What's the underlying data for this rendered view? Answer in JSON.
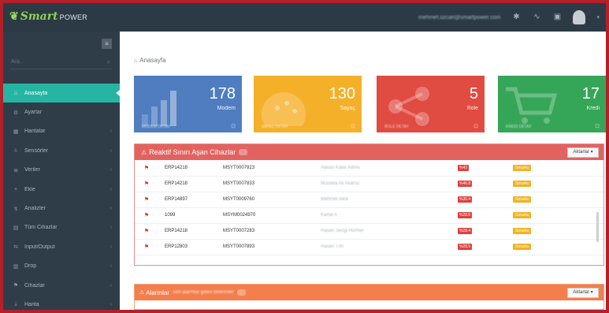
{
  "app": {
    "brand": "Smart",
    "brand_suffix": "POWER",
    "email": "mehmet.ozcan@smartpower.com"
  },
  "topbar": {
    "icons": [
      "tasks-icon",
      "rss-icon",
      "calendar-icon"
    ],
    "user_menu": "▾"
  },
  "sidebar": {
    "toggle_label": "≡",
    "search_placeholder": "Ara...",
    "items": [
      {
        "label": "Anasayfa",
        "icon": "⌂",
        "active": true,
        "arrow": ""
      },
      {
        "label": "Ayarlar",
        "icon": "⚙",
        "active": false,
        "arrow": ""
      },
      {
        "label": "Haritalar",
        "icon": "▦",
        "active": false,
        "arrow": "›"
      },
      {
        "label": "Sensörler",
        "icon": "⟂",
        "active": false,
        "arrow": "›"
      },
      {
        "label": "Veriler",
        "icon": "≣",
        "active": false,
        "arrow": "›"
      },
      {
        "label": "Ekle",
        "icon": "+",
        "active": false,
        "arrow": "›"
      },
      {
        "label": "Analizler",
        "icon": "↯",
        "active": false,
        "arrow": "›"
      },
      {
        "label": "Tüm Cihazlar",
        "icon": "▤",
        "active": false,
        "arrow": "›"
      },
      {
        "label": "Input/Output",
        "icon": "⇆",
        "active": false,
        "arrow": "›"
      },
      {
        "label": "Drop",
        "icon": "▥",
        "active": false,
        "arrow": "›"
      },
      {
        "label": "Cihazlar",
        "icon": "⚑",
        "active": false,
        "arrow": "›"
      },
      {
        "label": "Harita",
        "icon": "⇣",
        "active": false,
        "arrow": "›"
      }
    ]
  },
  "breadcrumb": {
    "home_icon": "⌂",
    "label": "Anasayfa"
  },
  "tiles": [
    {
      "number": "178",
      "label": "Modem",
      "footer": "MODEM DETAY",
      "color": "#4f7dc0"
    },
    {
      "number": "130",
      "label": "Sayaç",
      "footer": "SAYAÇ DETAY",
      "color": "#f5b02a"
    },
    {
      "number": "5",
      "label": "Role",
      "footer": "ROLE DETAY",
      "color": "#e04b42"
    },
    {
      "number": "17",
      "label": "Kredi",
      "footer": "KREDI DETAY",
      "color": "#35a657"
    }
  ],
  "panel1": {
    "title": "Reaktif Sınırı Aşan Cihazlar",
    "button": "Aktarlar ▾",
    "rows": [
      {
        "code": "ERP14218",
        "serial": "MSYT0007923",
        "name": "Hasan Kalar Adres",
        "percent": "%42",
        "status": "Sorunlu"
      },
      {
        "code": "ERP14218",
        "serial": "MSYT0007833",
        "name": "Mustafa Ali Akarsu",
        "percent": "%46.8",
        "status": "Sorunlu"
      },
      {
        "code": "ERP14897",
        "serial": "MSYT0009760",
        "name": "Mehmet Alka",
        "percent": "%30.4",
        "status": "Sorunlu"
      },
      {
        "code": "1099",
        "serial": "MSYM0024970",
        "name": "Kartal A",
        "percent": "%28.5",
        "status": "Sorunlu"
      },
      {
        "code": "ERP14218",
        "serial": "MSYT0007283",
        "name": "Hasan Sezgi Hizmet",
        "percent": "%28.4",
        "status": "Sorunlu"
      },
      {
        "code": "ERP12803",
        "serial": "MSYT0007893",
        "name": "Hasan Tıfıl",
        "percent": "%28.5",
        "status": "Sorunlu"
      }
    ]
  },
  "panel2": {
    "title": "Alarmlar",
    "subtitle": "Son alarmlar gelen bildirimler",
    "button": "Aktarlar ▾"
  },
  "colors": {
    "frame": "#b3202a",
    "topbar": "#2c3a45",
    "sidebar": "#2f3d48",
    "active": "#26b5a2",
    "panel1_header": "#e2625f",
    "panel2_header": "#f47e4c"
  }
}
